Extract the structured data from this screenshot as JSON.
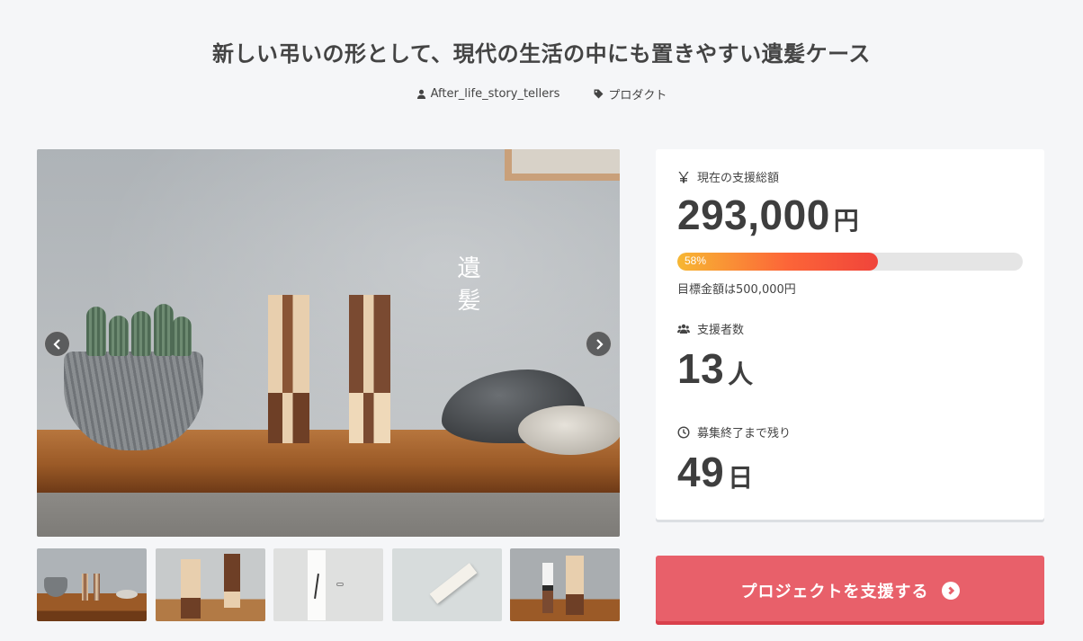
{
  "project": {
    "title": "新しい弔いの形として、現代の生活の中にも置きやすい遺髪ケース",
    "author": "After_life_story_tellers",
    "category": "プロダクト"
  },
  "hero": {
    "overlay_text": "遺髪",
    "prev_label": "previous image",
    "next_label": "next image",
    "thumbnail_count": 5
  },
  "stats": {
    "funding_label": "現在の支援総額",
    "funding_amount": "293,000",
    "funding_unit": "円",
    "progress_percent": 58,
    "progress_text": "58%",
    "goal_text": "目標金額は500,000円",
    "backers_label": "支援者数",
    "backers_count": "13",
    "backers_unit": "人",
    "remaining_label": "募集終了まで残り",
    "remaining_days": "49",
    "remaining_unit": "日"
  },
  "cta": {
    "label": "プロジェクトを支援する"
  },
  "colors": {
    "accent": "#e8606a",
    "progress_start": "#f7b733",
    "progress_end": "#f0443b"
  },
  "icons": [
    "person-icon",
    "tag-icon",
    "yen-icon",
    "users-icon",
    "clock-icon",
    "chevron-left-icon",
    "chevron-right-icon",
    "arrow-circle-right-icon"
  ]
}
